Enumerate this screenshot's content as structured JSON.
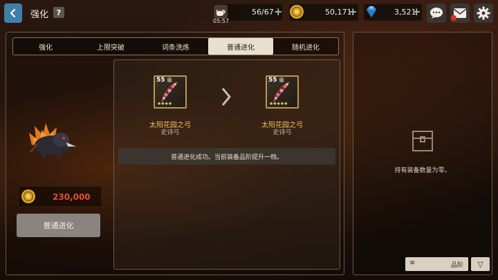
{
  "header": {
    "title": "强化",
    "help_label": "?",
    "stamina": "56/67",
    "stamina_timer": "05:57",
    "gold": "50,171",
    "gems": "3,521",
    "plus": "+"
  },
  "tabs": [
    {
      "label": "强化",
      "active": false
    },
    {
      "label": "上限突破",
      "active": false
    },
    {
      "label": "词条洗炼",
      "active": false
    },
    {
      "label": "普通进化",
      "active": true
    },
    {
      "label": "随机进化",
      "active": false
    }
  ],
  "evolution": {
    "from": {
      "level": "55",
      "level_unit": "级",
      "stars": "★★★★",
      "name": "太阳花园之弓",
      "grade": "史诗弓"
    },
    "to": {
      "level": "55",
      "level_unit": "级",
      "stars": "★★★★★",
      "name": "太阳花园之弓",
      "grade": "史诗弓"
    },
    "message": "普通进化成功。当前装备品阶提升一档。"
  },
  "cost": {
    "value": "230,000"
  },
  "evolve_button": "普通进化",
  "inventory": {
    "empty_message": "持有装备数量为零。",
    "grade_sort_label": "品阶",
    "sort_icon": "≡",
    "filter_icon": "▽"
  },
  "colors": {
    "accent_blue": "#3f7fa8",
    "cost_red": "#e84a3a",
    "item_name_gold": "#f0c060",
    "tab_active_bg": "#e8e0cf"
  }
}
